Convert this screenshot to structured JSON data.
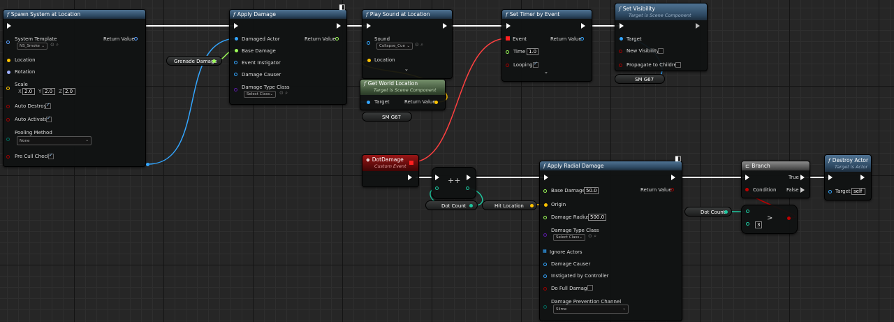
{
  "colors": {
    "exec": "#ffffff",
    "object": "#33a6ff",
    "vector": "#ffc400",
    "rotator": "#9fb0ff",
    "float": "#9cfb58",
    "bool": "#9c0000",
    "int": "#1ec8a0",
    "class": "#5a1aa4",
    "struct": "#0070ff",
    "byte": "#006a5d"
  },
  "spawn": {
    "title": "Spawn System at Location",
    "template_label": "System Template",
    "template_value": "NS_Smoke",
    "return_label": "Return Value",
    "location": "Location",
    "rotation": "Rotation",
    "scale": "Scale",
    "sx": "2.0",
    "sy": "2.0",
    "sz": "2.0",
    "ax": "X",
    "ay": "Y",
    "az": "Z",
    "auto_destroy": "Auto Destroy",
    "auto_activate": "Auto Activate",
    "pooling_label": "Pooling Method",
    "pooling_value": "None",
    "pre_cull": "Pre Cull Check"
  },
  "grenade_var": "Grenade Damage",
  "apply": {
    "title": "Apply Damage",
    "damaged_actor": "Damaged Actor",
    "return_label": "Return Value",
    "base_damage": "Base Damage",
    "instigator": "Event Instigator",
    "causer": "Damage Causer",
    "type_class": "Damage Type Class",
    "select_class": "Select Class"
  },
  "play": {
    "title": "Play Sound at Location",
    "sound": "Sound",
    "sound_value": "Collapse_Cue",
    "location": "Location"
  },
  "getloc": {
    "title": "Get World Location",
    "sub": "Target is Scene Component",
    "target": "Target",
    "return_label": "Return Value"
  },
  "sm_var1": "SM G67",
  "timer": {
    "title": "Set Timer by Event",
    "event": "Event",
    "return_label": "Return Value",
    "time": "Time",
    "time_value": "1.0",
    "looping": "Looping"
  },
  "vis": {
    "title": "Set Visibility",
    "sub": "Target is Scene Component",
    "target": "Target",
    "new_vis": "New Visibility",
    "propagate": "Propagate to Children"
  },
  "sm_var2": "SM G67",
  "dot": {
    "title": "DotDamage",
    "sub": "Custom Event"
  },
  "incr": {
    "label": "++"
  },
  "dot_count_var": "Dot Count",
  "hit_loc_var": "Hit Location",
  "radial": {
    "title": "Apply Radial Damage",
    "base_damage": "Base Damage",
    "base_value": "50.0",
    "return_label": "Return Value",
    "origin": "Origin",
    "radius": "Damage Radius",
    "radius_value": "500.0",
    "type_class": "Damage Type Class",
    "select_class": "Select Class",
    "ignore": "Ignore Actors",
    "causer": "Damage Causer",
    "instigated": "Instigated by Controller",
    "full": "Do Full Damage",
    "channel_label": "Damage Prevention Channel",
    "channel_value": "Slime"
  },
  "branch": {
    "title": "Branch",
    "true_label": "True",
    "condition": "Condition",
    "false_label": "False"
  },
  "dot_count_var2": "Dot Count",
  "compare": {
    "op": ">",
    "value": "3"
  },
  "destroy": {
    "title": "Destroy Actor",
    "sub": "Target is Actor",
    "target": "Target",
    "target_value": "self"
  }
}
